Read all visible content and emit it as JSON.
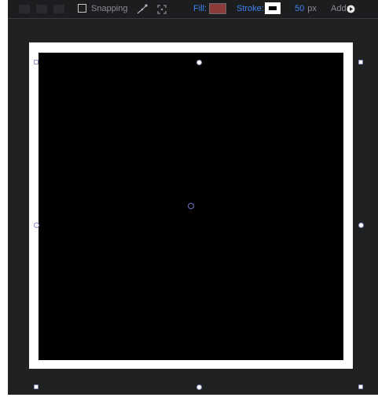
{
  "toolbar": {
    "snapping": {
      "label": "Snapping",
      "checked": false,
      "icons": [
        "snap-to-points-icon",
        "snap-to-edges-icon"
      ]
    },
    "fill": {
      "label": "Fill:",
      "color": "#8c3a3a"
    },
    "stroke": {
      "label": "Stroke:",
      "color": "#ffffff",
      "size_value": "50",
      "size_unit": "px"
    },
    "add": {
      "label": "Add:",
      "icon": "add-circle-icon"
    },
    "accent_color": "#3e82f0"
  },
  "canvas": {
    "background_color": "#202123",
    "shape": {
      "type": "rectangle",
      "fill_color": "#000000",
      "stroke_color": "#ffffff",
      "selected": true
    }
  }
}
